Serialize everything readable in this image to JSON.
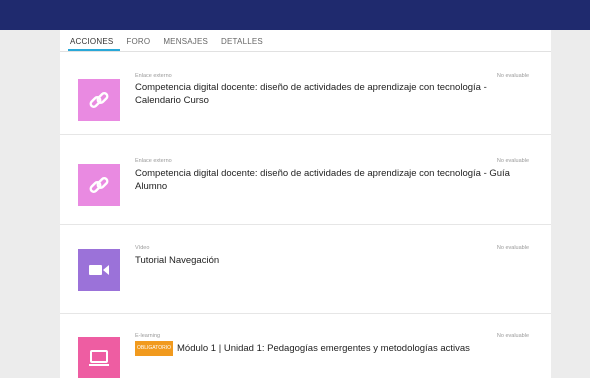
{
  "tabs": [
    {
      "label": "ACCIONES",
      "active": true
    },
    {
      "label": "FORO",
      "active": false
    },
    {
      "label": "MENSAJES",
      "active": false
    },
    {
      "label": "DETALLES",
      "active": false
    }
  ],
  "items": [
    {
      "type": "Enlace externo",
      "evaluation": "No evaluable",
      "title": "Competencia digital docente: diseño de actividades de aprendizaje con tecnología - Calendario Curso",
      "icon": "link-icon",
      "color": "#e98ae1"
    },
    {
      "type": "Enlace externo",
      "evaluation": "No evaluable",
      "title": "Competencia digital docente: diseño de actividades de aprendizaje con tecnología - Guía Alumno",
      "icon": "link-icon",
      "color": "#e98ae1"
    },
    {
      "type": "Vídeo",
      "evaluation": "No evaluable",
      "title": "Tutorial Navegación",
      "icon": "video-camera-icon",
      "color": "#9b72d9"
    },
    {
      "type": "E-learning",
      "evaluation": "No evaluable",
      "badge": "OBLIGATORIO",
      "title": "Módulo 1 | Unidad 1: Pedagogías emergentes y metodologías activas",
      "icon": "laptop-icon",
      "color": "#ee5da2"
    }
  ],
  "colors": {
    "topbar": "#1f2a6e",
    "active_tab_underline": "#29a8d8",
    "badge": "#f19a1e"
  }
}
